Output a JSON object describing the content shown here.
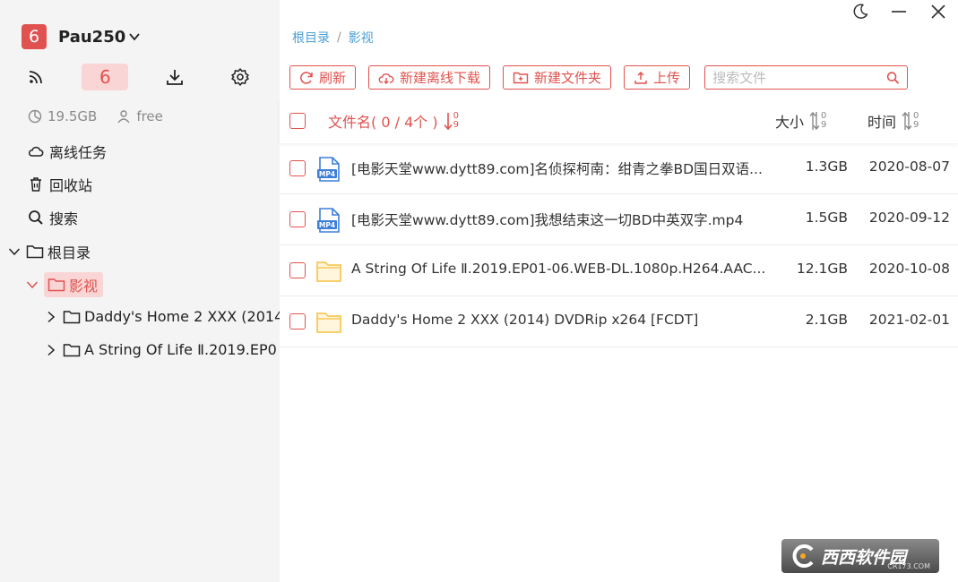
{
  "app": {
    "logo_text": "6",
    "username": "Pau250"
  },
  "topnav": {
    "active_label": "6"
  },
  "stats": {
    "storage": "19.5GB",
    "plan": "free"
  },
  "menu": {
    "offline_tasks": "离线任务",
    "recycle_bin": "回收站",
    "search": "搜索"
  },
  "tree": {
    "root": "根目录",
    "current": "影视",
    "children": [
      "Daddy's Home 2 XXX (2014",
      "A String Of Life Ⅱ.2019.EP0"
    ]
  },
  "breadcrumb": {
    "root": "根目录",
    "sep": "/",
    "current": "影视"
  },
  "toolbar": {
    "refresh": "刷新",
    "new_offline_download": "新建离线下载",
    "new_folder": "新建文件夹",
    "upload": "上传",
    "search_placeholder": "搜索文件"
  },
  "table": {
    "name_header": "文件名( 0 / 4个 )",
    "size_header": "大小",
    "time_header": "时间",
    "sort_top": "0",
    "sort_bottom": "9",
    "rows": [
      {
        "type": "mp4",
        "name": "[电影天堂www.dytt89.com]名侦探柯南：绀青之拳BD国日双语...",
        "size": "1.3GB",
        "time": "2020-08-07"
      },
      {
        "type": "mp4",
        "name": "[电影天堂www.dytt89.com]我想结束这一切BD中英双字.mp4",
        "size": "1.5GB",
        "time": "2020-09-12"
      },
      {
        "type": "folder",
        "name": "A String Of Life Ⅱ.2019.EP01-06.WEB-DL.1080p.H264.AAC...",
        "size": "12.1GB",
        "time": "2020-10-08"
      },
      {
        "type": "folder",
        "name": "Daddy's Home 2 XXX (2014) DVDRip x264 [FCDT]",
        "size": "2.1GB",
        "time": "2021-02-01"
      }
    ]
  },
  "file_badge": "MP4",
  "watermark": {
    "text": "西西软件园",
    "sub": "CR173.COM"
  },
  "colors": {
    "accent": "#e0524f",
    "accent_light": "#f9d6d5",
    "link": "#4a9fd6",
    "sidebar_bg": "#f5f4f5",
    "folder": "#f7c95a",
    "mp4": "#3d7fd9"
  }
}
